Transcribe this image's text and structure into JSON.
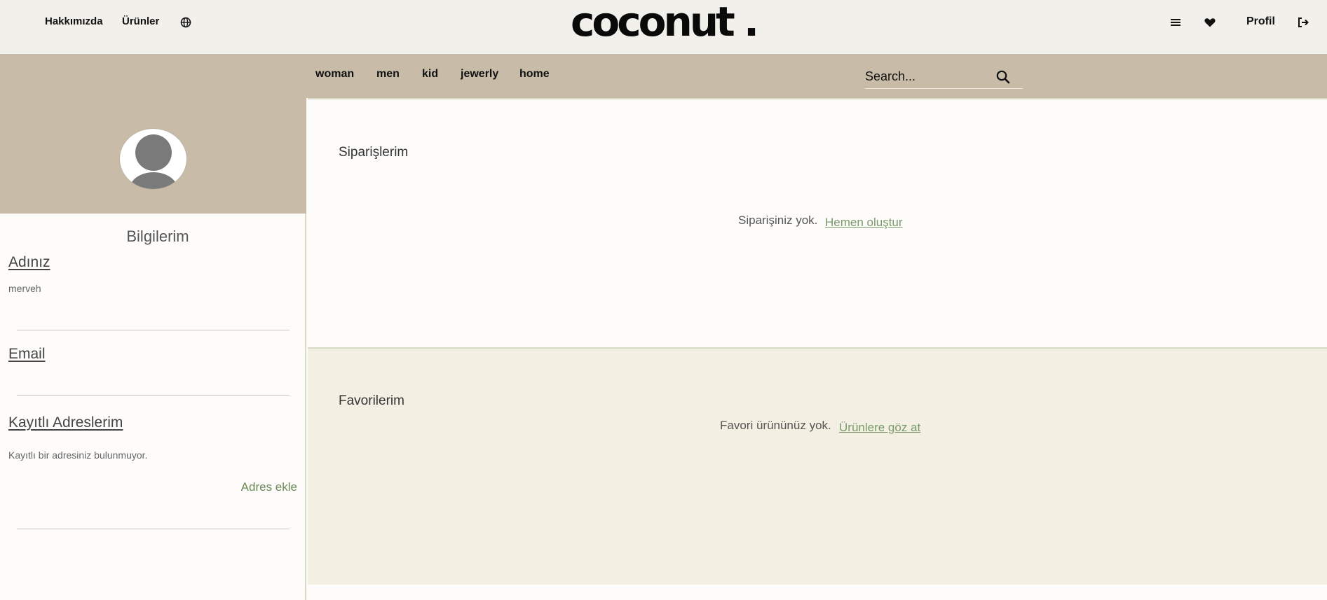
{
  "header": {
    "nav_left": [
      "Hakkımızda",
      "Ürünler"
    ],
    "logo_text": "coconut .",
    "profile_label": "Profil",
    "icons": [
      "globe-icon",
      "menu-icon",
      "heart-icon",
      "logout-icon"
    ]
  },
  "categories": [
    "woman",
    "men",
    "kid",
    "jewerly",
    "home"
  ],
  "search": {
    "placeholder": "Search...",
    "value": ""
  },
  "sidebar": {
    "title": "Bilgilerim",
    "name_label": "Adınız",
    "name_value": "merveh",
    "email_label": "Email",
    "email_value": "",
    "address_label": "Kayıtlı Adreslerim",
    "address_empty": "Kayıtlı bir adresiniz bulunmuyor.",
    "address_add": "Adres ekle"
  },
  "orders": {
    "title": "Siparişlerim",
    "empty_text": "Siparişiniz yok.",
    "empty_link": "Hemen oluştur"
  },
  "favorites": {
    "title": "Favorilerim",
    "empty_text": "Favori ürününüz yok.",
    "empty_link": "Ürünlere göz at"
  },
  "colors": {
    "header_bg": "#f2f0eb",
    "category_bar_bg": "#c8bca9",
    "favorites_bg": "#f3f0e3",
    "link_green": "#7a9a6a"
  }
}
